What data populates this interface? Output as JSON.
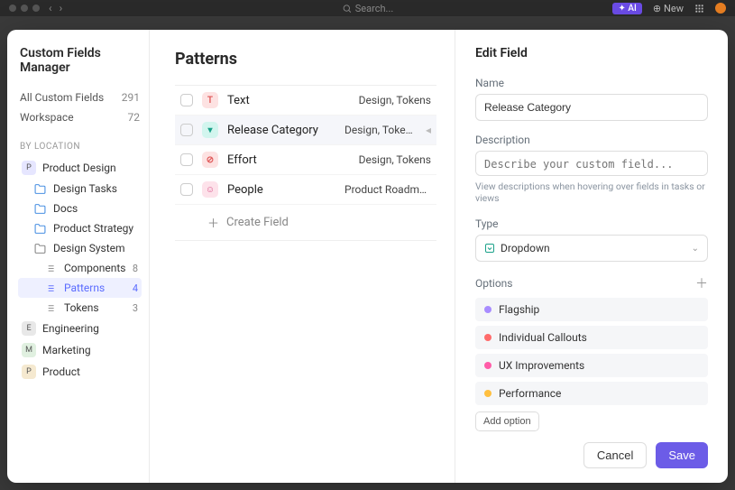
{
  "topbar": {
    "search_placeholder": "Search...",
    "ai_label": "AI",
    "new_label": "New"
  },
  "sidebar": {
    "title": "Custom Fields Manager",
    "all_label": "All Custom Fields",
    "all_count": "291",
    "workspace_label": "Workspace",
    "workspace_count": "72",
    "section_label": "BY LOCATION",
    "spaces": [
      {
        "badge": "P",
        "badge_bg": "#e6e6ff",
        "label": "Product Design"
      },
      {
        "badge": "E",
        "badge_bg": "#e8e8e8",
        "label": "Engineering"
      },
      {
        "badge": "M",
        "badge_bg": "#e0f0e0",
        "label": "Marketing"
      },
      {
        "badge": "P",
        "badge_bg": "#f5e9d0",
        "label": "Product"
      }
    ],
    "folders": [
      {
        "label": "Design Tasks"
      },
      {
        "label": "Docs"
      },
      {
        "label": "Product Strategy"
      },
      {
        "label": "Design System"
      }
    ],
    "lists": [
      {
        "label": "Components",
        "count": "8"
      },
      {
        "label": "Patterns",
        "count": "4"
      },
      {
        "label": "Tokens",
        "count": "3"
      }
    ]
  },
  "main": {
    "title": "Patterns",
    "rows": [
      {
        "name": "Text",
        "location": "Design, Tokens",
        "badge": "T",
        "badge_bg": "#fde2e2",
        "badge_fg": "#e05a5a"
      },
      {
        "name": "Release Category",
        "location": "Design, Tokens",
        "badge": "▾",
        "badge_bg": "#d2f5ee",
        "badge_fg": "#1aa189"
      },
      {
        "name": "Effort",
        "location": "Design, Tokens",
        "badge": "⊘",
        "badge_bg": "#fde2e2",
        "badge_fg": "#e05a5a"
      },
      {
        "name": "People",
        "location": "Product Roadmap",
        "badge": "☺",
        "badge_bg": "#fde2ea",
        "badge_fg": "#d8548a"
      }
    ],
    "create_label": "Create Field"
  },
  "panel": {
    "title": "Edit Field",
    "labels": {
      "name": "Name",
      "description": "Description",
      "type": "Type",
      "options": "Options"
    },
    "name_value": "Release Category",
    "description_placeholder": "Describe your custom field...",
    "description_hint": "View descriptions when hovering over fields in tasks or views",
    "type_value": "Dropdown",
    "options": [
      {
        "label": "Flagship",
        "color": "#a88cff"
      },
      {
        "label": "Individual Callouts",
        "color": "#ff6b6b"
      },
      {
        "label": "UX Improvements",
        "color": "#ff5ca8"
      },
      {
        "label": "Performance",
        "color": "#ffbf3f"
      }
    ],
    "add_option_label": "Add option",
    "cancel_label": "Cancel",
    "save_label": "Save"
  }
}
